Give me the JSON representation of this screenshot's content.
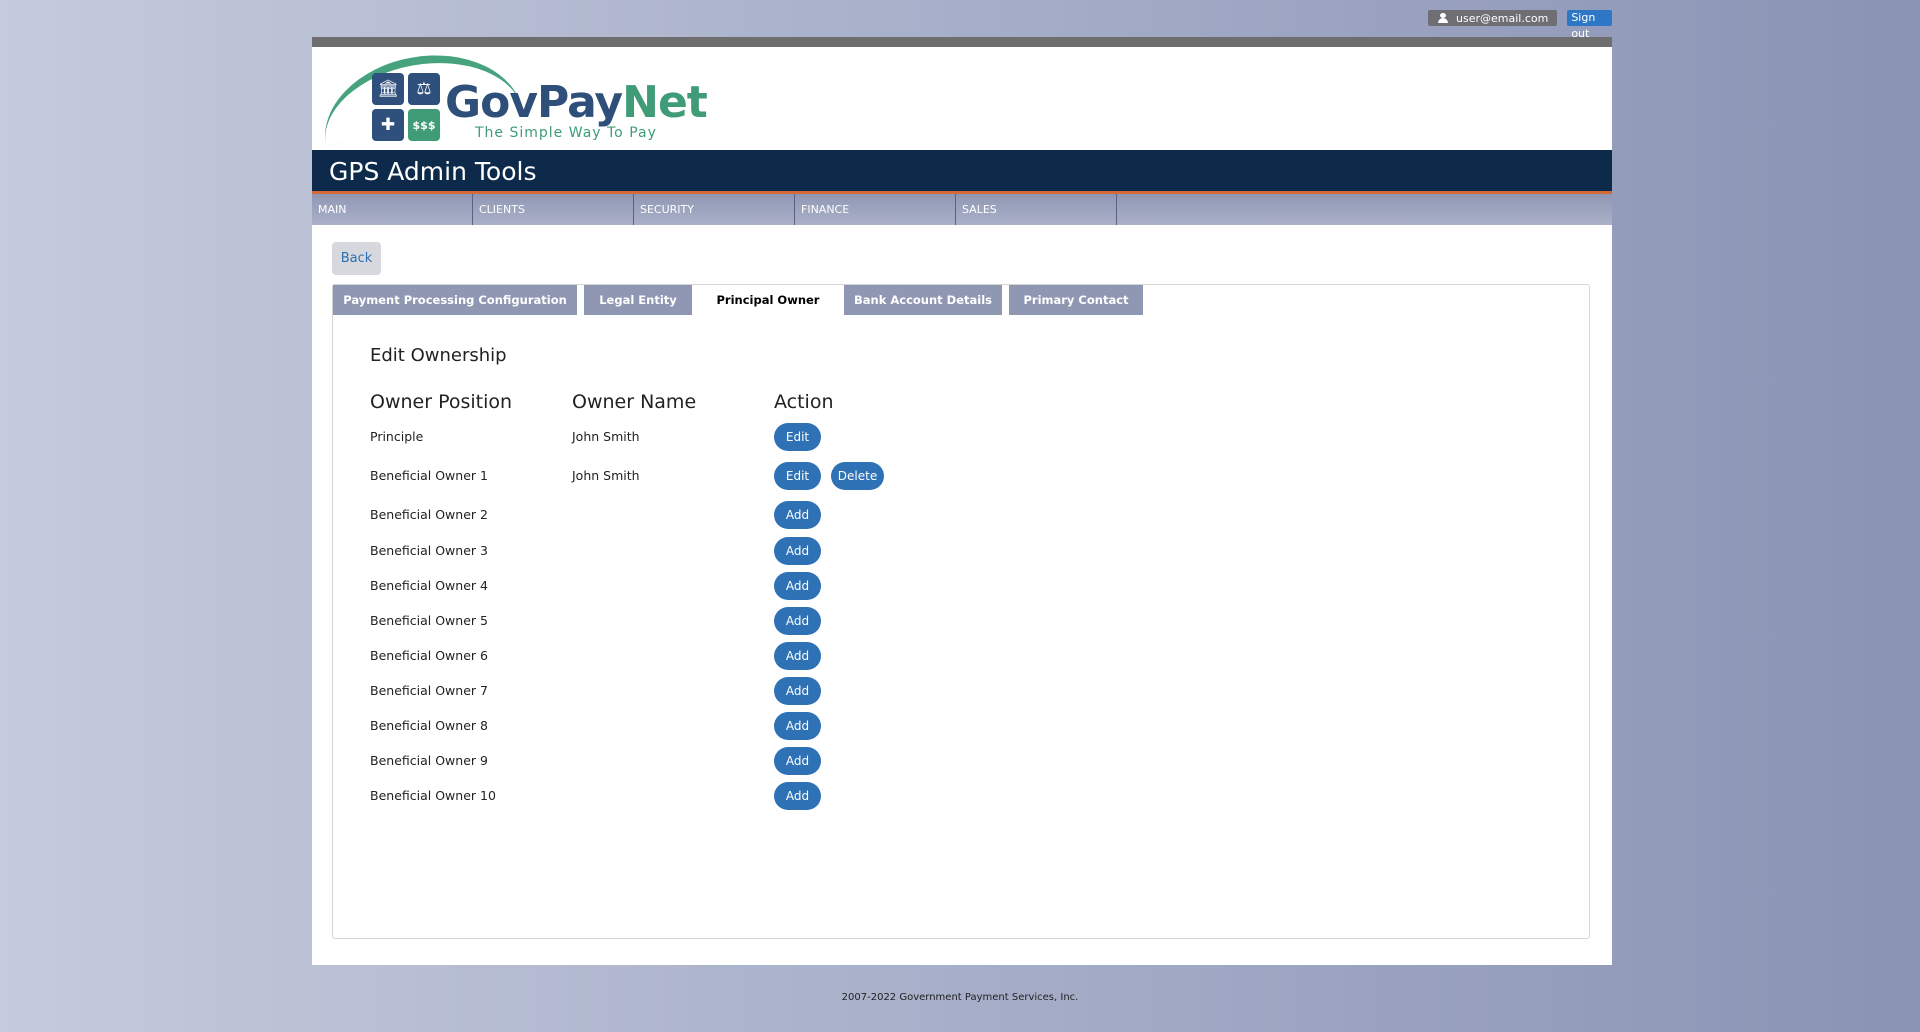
{
  "user_bar": {
    "email": "user@email.com",
    "signout": "Sign out"
  },
  "logo": {
    "name_part1": "GovPay",
    "name_part2": "Net",
    "tagline": "The Simple Way To Pay",
    "money_sign": "$$$"
  },
  "header": {
    "title": "GPS Admin Tools"
  },
  "nav": {
    "items": [
      "MAIN",
      "CLIENTS",
      "SECURITY",
      "FINANCE",
      "SALES"
    ]
  },
  "back_label": "Back",
  "tabs": [
    {
      "label": "Payment Processing Configuration",
      "active": false
    },
    {
      "label": "Legal Entity",
      "active": false
    },
    {
      "label": "Principal Owner",
      "active": true
    },
    {
      "label": "Bank Account Details",
      "active": false
    },
    {
      "label": "Primary Contact",
      "active": false
    }
  ],
  "section": {
    "title": "Edit Ownership",
    "columns": [
      "Owner Position",
      "Owner Name",
      "Action"
    ],
    "rows": [
      {
        "position": "Principle",
        "name": "John Smith",
        "actions": [
          "Edit"
        ]
      },
      {
        "position": "Beneficial Owner 1",
        "name": "John Smith",
        "actions": [
          "Edit",
          "Delete"
        ]
      },
      {
        "position": "Beneficial Owner 2",
        "name": "",
        "actions": [
          "Add"
        ]
      },
      {
        "position": "Beneficial Owner 3",
        "name": "",
        "actions": [
          "Add"
        ]
      },
      {
        "position": "Beneficial Owner 4",
        "name": "",
        "actions": [
          "Add"
        ]
      },
      {
        "position": "Beneficial Owner 5",
        "name": "",
        "actions": [
          "Add"
        ]
      },
      {
        "position": "Beneficial Owner 6",
        "name": "",
        "actions": [
          "Add"
        ]
      },
      {
        "position": "Beneficial Owner 7",
        "name": "",
        "actions": [
          "Add"
        ]
      },
      {
        "position": "Beneficial Owner 8",
        "name": "",
        "actions": [
          "Add"
        ]
      },
      {
        "position": "Beneficial Owner 9",
        "name": "",
        "actions": [
          "Add"
        ]
      },
      {
        "position": "Beneficial Owner 10",
        "name": "",
        "actions": [
          "Add"
        ]
      }
    ]
  },
  "footer": "2007-2022 Government Payment Services, Inc.",
  "colors": {
    "header_bg": "#0d2a4a",
    "accent": "#d46a38",
    "button": "#2e72b5",
    "nav_bg": "#8f97b3",
    "logo_blue": "#2e4f79",
    "logo_green": "#3f9c77"
  }
}
